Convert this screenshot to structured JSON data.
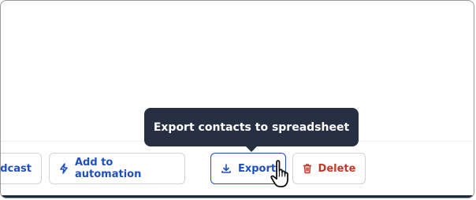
{
  "actions": {
    "broadcast_label": "dcast",
    "automation_label": "Add to automation",
    "export_label": "Export",
    "delete_label": "Delete"
  },
  "tooltip": {
    "text": "Export contacts to spreadsheet"
  },
  "icons": {
    "automation": "lightning-icon",
    "export": "download-icon",
    "delete": "trash-icon",
    "cursor": "hand-pointer-cursor"
  },
  "colors": {
    "accent_blue": "#1f4fbf",
    "danger_red": "#c0392b",
    "tooltip_bg": "#263042",
    "border": "#cfd3da",
    "bottom_bar": "#1e2a3b"
  }
}
